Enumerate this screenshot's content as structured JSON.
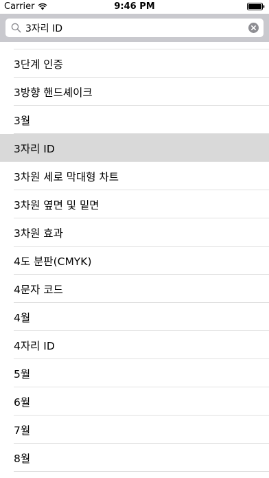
{
  "status_bar": {
    "carrier": "Carrier",
    "time": "9:46 PM",
    "wifi_icon": "wifi-icon",
    "battery_icon": "battery-icon"
  },
  "search": {
    "value": "3자리 ID",
    "search_icon": "search-icon",
    "clear_icon": "clear-icon"
  },
  "list": {
    "items": [
      {
        "label": "3단계 인증"
      },
      {
        "label": "3방향 핸드셰이크"
      },
      {
        "label": "3월"
      },
      {
        "label": "3자리 ID",
        "selected": true
      },
      {
        "label": "3차원 세로 막대형 차트"
      },
      {
        "label": "3차원 옆면 및 밑면"
      },
      {
        "label": "3차원 효과"
      },
      {
        "label": "4도 분판(CMYK)"
      },
      {
        "label": "4문자 코드"
      },
      {
        "label": "4월"
      },
      {
        "label": "4자리 ID"
      },
      {
        "label": "5월"
      },
      {
        "label": "6월"
      },
      {
        "label": "7월"
      },
      {
        "label": "8월"
      }
    ]
  },
  "colors": {
    "search_bar_bg": "#c9c9ce",
    "selected_row_bg": "#d9d9d9",
    "separator": "#e0e0e0"
  }
}
